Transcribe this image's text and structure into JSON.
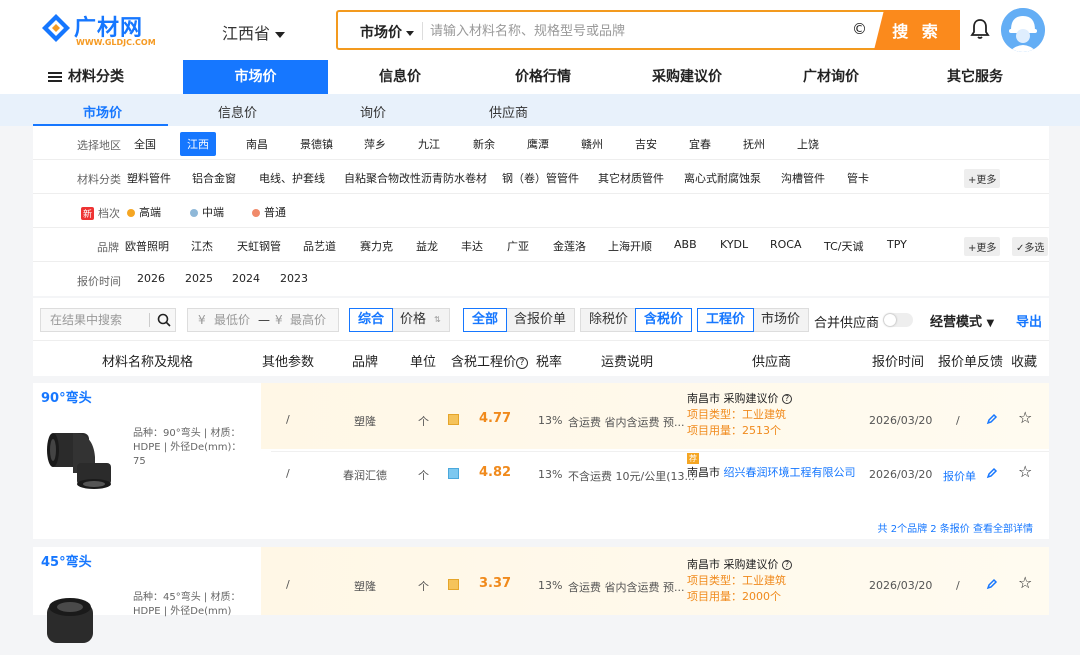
{
  "logo": {
    "name": "广材网",
    "url": "WWW.GLDJC.COM"
  },
  "province": "江西省",
  "search": {
    "category": "市场价",
    "placeholder": "请输入材料名称、规格型号或品牌",
    "button": "搜 索"
  },
  "nav": {
    "menu": "材料分类",
    "items": [
      "市场价",
      "信息价",
      "价格行情",
      "采购建议价",
      "广材询价",
      "其它服务"
    ]
  },
  "subnav": [
    "市场价",
    "信息价",
    "询价",
    "供应商"
  ],
  "filters": {
    "region": {
      "label": "选择地区",
      "options": [
        "全国",
        "江西",
        "南昌",
        "景德镇",
        "萍乡",
        "九江",
        "新余",
        "鹰潭",
        "赣州",
        "吉安",
        "宜春",
        "抚州",
        "上饶"
      ]
    },
    "category": {
      "label": "材料分类",
      "options": [
        "塑料管件",
        "铝合金窗",
        "电线、护套线",
        "自粘聚合物改性沥青防水卷材",
        "钢（卷）管管件",
        "其它材质管件",
        "离心式耐腐蚀泵",
        "沟槽管件",
        "管卡"
      ],
      "more": "+更多"
    },
    "grade": {
      "badge": "新",
      "label": "档次",
      "options": [
        "高端",
        "中端",
        "普通"
      ],
      "colors": [
        "#f5a623",
        "#8fb8d8",
        "#f08a6a"
      ]
    },
    "brand": {
      "label": "品牌",
      "options": [
        "欧普照明",
        "江杰",
        "天虹钢管",
        "品艺道",
        "赛力克",
        "益龙",
        "丰达",
        "广亚",
        "金莲洛",
        "上海开顺",
        "ABB",
        "KYDL",
        "ROCA",
        "TC/天诚",
        "TPY"
      ],
      "more": "+更多",
      "multi": "多选"
    },
    "time": {
      "label": "报价时间",
      "options": [
        "2026",
        "2025",
        "2024",
        "2023"
      ]
    }
  },
  "toolbar": {
    "search_placeholder": "在结果中搜索",
    "min_placeholder": "最低价",
    "max_placeholder": "最高价",
    "yen": "¥",
    "dash": "—",
    "sort": [
      "综合",
      "价格"
    ],
    "scope": [
      "全部",
      "含报价单"
    ],
    "tax": [
      "除税价",
      "含税价"
    ],
    "price_type": [
      "工程价",
      "市场价"
    ],
    "merge": "合并供应商",
    "mode": "经营模式",
    "export": "导出"
  },
  "columns": [
    "材料名称及规格",
    "其他参数",
    "品牌",
    "单位",
    "含税工程价",
    "税率",
    "运费说明",
    "供应商",
    "报价时间",
    "报价单",
    "反馈",
    "收藏"
  ],
  "products": [
    {
      "name": "90°弯头",
      "spec": "品种：90°弯头 | 材质：HDPE | 外径De(mm)：75",
      "rows": [
        {
          "params": "/",
          "brand": "塑隆",
          "unit": "个",
          "price": "4.77",
          "tax": "13%",
          "freight": "含运费 省内含运费 预...",
          "supplier_city": "南昌市",
          "supplier_name": "采购建议价",
          "type_label": "项目类型：",
          "type_val": "工业建筑",
          "use_label": "项目用量：",
          "use_val": "2513个",
          "date": "2026/03/20",
          "quote": "/"
        },
        {
          "params": "/",
          "brand": "春润汇德",
          "unit": "个",
          "price": "4.82",
          "tax": "13%",
          "freight": "不含运费 10元/公里(13...",
          "supplier_city": "南昌市",
          "supplier_name": "绍兴春润环境工程有限公司",
          "badge": "荐",
          "date": "2026/03/20",
          "quote": "报价单"
        }
      ],
      "footer": "共 2个品牌 2 条报价 查看全部详情"
    },
    {
      "name": "45°弯头",
      "spec": "品种：45°弯头 | 材质：HDPE | 外径De(mm)",
      "rows": [
        {
          "params": "/",
          "brand": "塑隆",
          "unit": "个",
          "price": "3.37",
          "tax": "13%",
          "freight": "含运费 省内含运费 预...",
          "supplier_city": "南昌市",
          "supplier_name": "采购建议价",
          "type_label": "项目类型：",
          "type_val": "工业建筑",
          "use_label": "项目用量：",
          "use_val": "2000个",
          "date": "2026/03/20",
          "quote": "/"
        }
      ]
    }
  ],
  "colors": {
    "accent": "#1677ff",
    "orange": "#f08a1c"
  }
}
